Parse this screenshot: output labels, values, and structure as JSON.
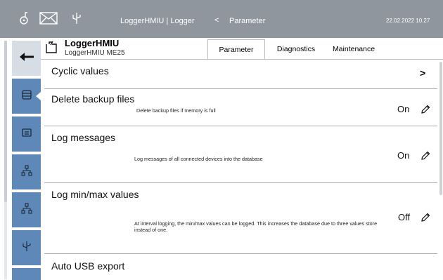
{
  "topbar": {
    "title": "LoggerHMIU | Logger",
    "back_arrow": "<",
    "breadcrumb": "Parameter",
    "datetime": "22.02.2022  10.27"
  },
  "device": {
    "name": "LoggerHMIU",
    "model": "LoggerHMIU ME25"
  },
  "tabs": [
    {
      "label": "Parameter",
      "active": true
    },
    {
      "label": "Diagnostics",
      "active": false
    },
    {
      "label": "Maintenance",
      "active": false
    }
  ],
  "rows": [
    {
      "label": "Cyclic values",
      "chevron": ">"
    },
    {
      "label": "Delete backup files",
      "description": "Delete backup files if memory is full",
      "value": "On"
    },
    {
      "label": "Log messages",
      "description": "Log messages of all connected devices into the database",
      "value": "On"
    },
    {
      "label": "Log min/max values",
      "description": "At interval logging, the min/max values can be logged. This increases the database due to three values store instead of one.",
      "value": "Off"
    },
    {
      "label": "Auto USB export"
    }
  ],
  "colors": {
    "topbar": "#8f969e",
    "nav_blue": "#5e88b8",
    "nav_back": "#d6dde4"
  }
}
